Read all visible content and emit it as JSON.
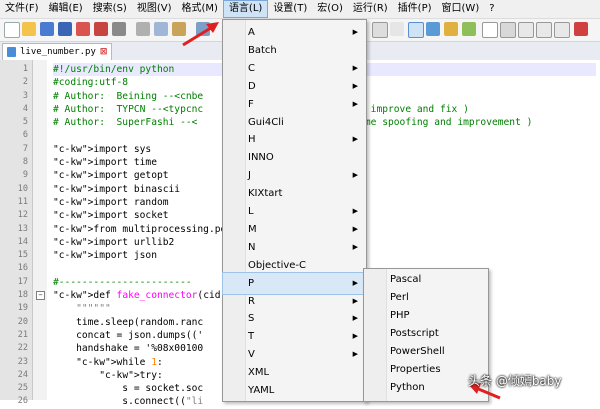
{
  "menubar": {
    "items": [
      "文件(F)",
      "编辑(E)",
      "搜索(S)",
      "视图(V)",
      "格式(M)",
      "语言(L)",
      "设置(T)",
      "宏(O)",
      "运行(R)",
      "插件(P)",
      "窗口(W)",
      "?"
    ],
    "active": "语言(L)"
  },
  "tab": {
    "filename": "live_number.py",
    "close": "⊠"
  },
  "code": {
    "lines": [
      {
        "n": "1",
        "t": "#!/usr/bin/env python"
      },
      {
        "n": "2",
        "t": "#coding:utf-8"
      },
      {
        "n": "3",
        "t": "# Author:  Beining --<cnbe"
      },
      {
        "n": "4",
        "t": "# Author:  TYPCN --<typcnc                        ance improve and fix )"
      },
      {
        "n": "5",
        "t": "# Author:  SuperFashi --<                       For some spoofing and improvement )"
      },
      {
        "n": "6",
        "t": ""
      },
      {
        "n": "7",
        "t": "import sys"
      },
      {
        "n": "8",
        "t": "import time"
      },
      {
        "n": "9",
        "t": "import getopt"
      },
      {
        "n": "10",
        "t": "import binascii"
      },
      {
        "n": "11",
        "t": "import random"
      },
      {
        "n": "12",
        "t": "import socket"
      },
      {
        "n": "13",
        "t": "from multiprocessing.pool"
      },
      {
        "n": "14",
        "t": "import urllib2"
      },
      {
        "n": "15",
        "t": "import json"
      },
      {
        "n": "16",
        "t": ""
      },
      {
        "n": "17",
        "t": "#-----------------------                        -------------------------"
      },
      {
        "n": "18",
        "t": "def fake_connector(cid, fa"
      },
      {
        "n": "19",
        "t": "    \"\"\"\"\"\""
      },
      {
        "n": "20",
        "t": "    time.sleep(random.ranc"
      },
      {
        "n": "21",
        "t": "    concat = json.dumps(('"
      },
      {
        "n": "22",
        "t": "    handshake = '%08x00100"
      },
      {
        "n": "23",
        "t": "    while 1:"
      },
      {
        "n": "24",
        "t": "        try:"
      },
      {
        "n": "25",
        "t": "            s = socket.soc"
      },
      {
        "n": "26",
        "t": "            s.connect((\"li"
      }
    ]
  },
  "language_menu": {
    "items": [
      {
        "label": "A",
        "submenu": true
      },
      {
        "label": "Batch",
        "submenu": false
      },
      {
        "label": "C",
        "submenu": true
      },
      {
        "label": "D",
        "submenu": true
      },
      {
        "label": "F",
        "submenu": true
      },
      {
        "label": "Gui4Cli",
        "submenu": false
      },
      {
        "label": "H",
        "submenu": true
      },
      {
        "label": "INNO",
        "submenu": false
      },
      {
        "label": "J",
        "submenu": true
      },
      {
        "label": "KIXtart",
        "submenu": false
      },
      {
        "label": "L",
        "submenu": true
      },
      {
        "label": "M",
        "submenu": true
      },
      {
        "label": "N",
        "submenu": true
      },
      {
        "label": "Objective-C",
        "submenu": false
      },
      {
        "label": "P",
        "submenu": true
      },
      {
        "label": "R",
        "submenu": true
      },
      {
        "label": "S",
        "submenu": true
      },
      {
        "label": "T",
        "submenu": true
      },
      {
        "label": "V",
        "submenu": true
      },
      {
        "label": "XML",
        "submenu": false
      },
      {
        "label": "YAML",
        "submenu": false
      }
    ],
    "highlighted": "P",
    "arrow_glyph": "▶"
  },
  "p_submenu": {
    "items": [
      "Pascal",
      "Perl",
      "PHP",
      "Postscript",
      "PowerShell",
      "Properties",
      "Python"
    ]
  },
  "watermark": "头条 @倾嫣baby",
  "colors": {
    "comment": "#008000",
    "keyword": "#0000ff",
    "function": "#ff00ff",
    "highlight": "#d9e8f7",
    "annotation_arrow": "#e02020"
  }
}
